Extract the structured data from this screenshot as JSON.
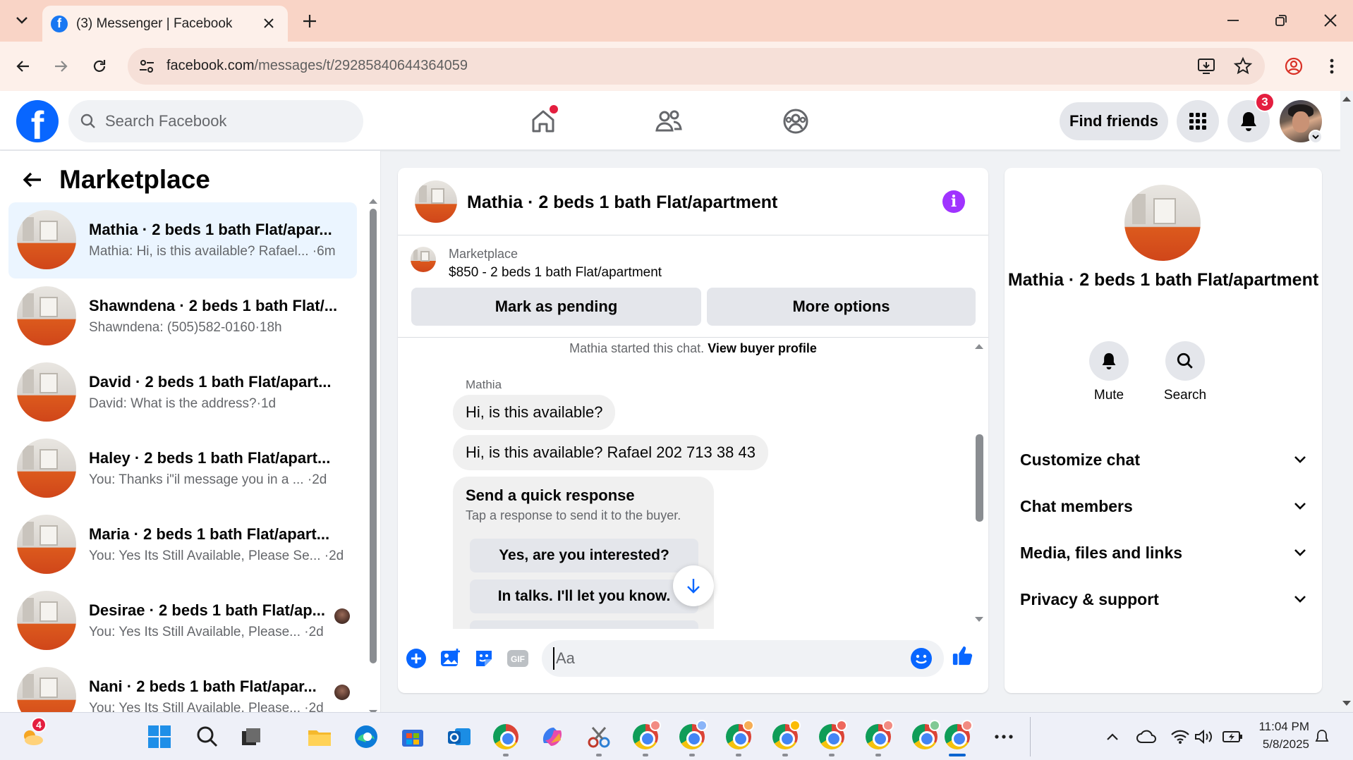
{
  "browser": {
    "tab_title": "(3) Messenger | Facebook",
    "url_host": "facebook.com",
    "url_path": "/messages/t/29285840644364059"
  },
  "fb_header": {
    "search_placeholder": "Search Facebook",
    "find_friends": "Find friends",
    "notifications_count": "3"
  },
  "left": {
    "title": "Marketplace",
    "conversations": [
      {
        "name": "Mathia · 2 beds 1 bath Flat/apar...",
        "snippet": "Mathia: Hi, is this available? Rafael... ·6m",
        "active": true
      },
      {
        "name": "Shawndena · 2 beds 1 bath Flat/...",
        "snippet": "Shawndena: (505)582-0160·18h"
      },
      {
        "name": "David · 2 beds 1 bath Flat/apart...",
        "snippet": "David: What is the address?·1d"
      },
      {
        "name": "Haley · 2 beds 1 bath Flat/apart...",
        "snippet": "You: Thanks i\"il message you in a ...   ·2d"
      },
      {
        "name": "Maria · 2 beds 1 bath Flat/apart...",
        "snippet": "You: Yes Its Still Available, Please Se... ·2d"
      },
      {
        "name": "Desirae · 2 beds 1 bath Flat/ap...",
        "snippet": "You: Yes Its Still Available, Please... ·2d"
      },
      {
        "name": "Nani · 2 beds 1 bath Flat/apar...",
        "snippet": "You: Yes Its Still Available, Please... ·2d"
      }
    ]
  },
  "chat": {
    "title": "Mathia · 2 beds 1 bath Flat/apartment",
    "marketplace_label": "Marketplace",
    "listing": "$850 - 2 beds 1 bath Flat/apartment",
    "mark_pending": "Mark as pending",
    "more_options": "More options",
    "started_text": "Mathia started this chat.",
    "view_buyer": "View buyer profile",
    "sender": "Mathia",
    "msg1": "Hi, is this available?",
    "msg2": "Hi, is this available? Rafael 202 713 38 43",
    "quick_title": "Send a quick response",
    "quick_sub": "Tap a response to send it to the buyer.",
    "quick_1": "Yes, are you interested?",
    "quick_2": "In talks. I'll let you know.",
    "input_placeholder": "Aa"
  },
  "right": {
    "title": "Mathia · 2 beds 1 bath Flat/apartment",
    "mute": "Mute",
    "search": "Search",
    "rows": [
      "Customize chat",
      "Chat members",
      "Media, files and links",
      "Privacy & support"
    ]
  },
  "taskbar": {
    "widgets_badge": "4",
    "time": "11:04 PM",
    "date": "5/8/2025"
  },
  "colors": {
    "fb_blue": "#0866ff",
    "messenger_purple": "#a033ff",
    "active_conv_bg": "#ebf5ff",
    "chrome_tab_bar": "#f9d4c6"
  }
}
